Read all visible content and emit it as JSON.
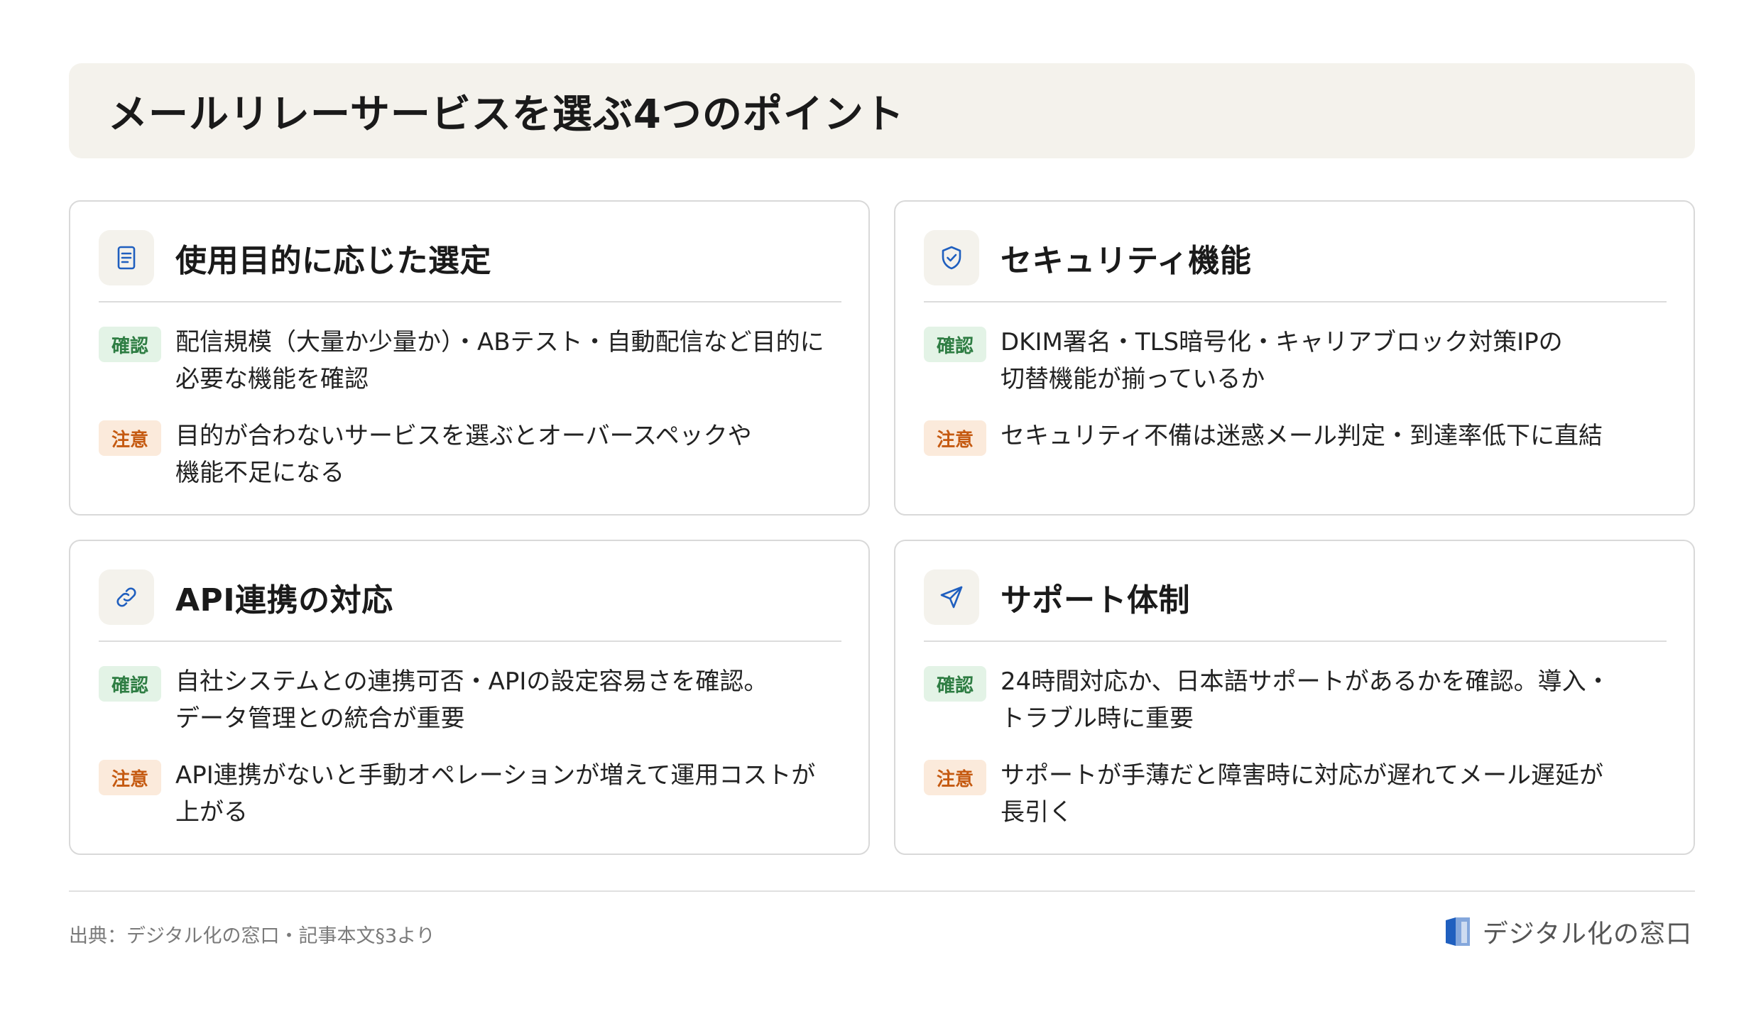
{
  "title": "メールリレーサービスを選ぶ4つのポイント",
  "labels": {
    "confirm": "確認",
    "caution": "注意"
  },
  "cards": [
    {
      "icon": "document-icon",
      "heading": "使用目的に応じた選定",
      "confirm_lines": [
        "配信規模（大量か少量か）・ABテスト・自動配信など目的に",
        "必要な機能を確認"
      ],
      "caution_lines": [
        "目的が合わないサービスを選ぶとオーバースペックや",
        "機能不足になる"
      ]
    },
    {
      "icon": "shield-check-icon",
      "heading": "セキュリティ機能",
      "confirm_lines": [
        "DKIM署名・TLS暗号化・キャリアブロック対策IPの",
        "切替機能が揃っているか"
      ],
      "caution_lines": [
        "セキュリティ不備は迷惑メール判定・到達率低下に直結"
      ]
    },
    {
      "icon": "link-icon",
      "heading": "API連携の対応",
      "confirm_lines": [
        "自社システムとの連携可否・APIの設定容易さを確認。",
        "データ管理との統合が重要"
      ],
      "caution_lines": [
        "API連携がないと手動オペレーションが増えて運用コストが",
        "上がる"
      ]
    },
    {
      "icon": "send-icon",
      "heading": "サポート体制",
      "confirm_lines": [
        "24時間対応か、日本語サポートがあるかを確認。導入・",
        "トラブル時に重要"
      ],
      "caution_lines": [
        "サポートが手薄だと障害時に対応が遅れてメール遅延が",
        "長引く"
      ]
    }
  ],
  "footer": {
    "source": "出典：デジタル化の窓口・記事本文§3より",
    "brand": "デジタル化の窓口"
  },
  "colors": {
    "accent_blue": "#1f5fbf",
    "confirm_bg": "#e3f3e6",
    "confirm_text": "#2e7d43",
    "caution_bg": "#fbeadb",
    "caution_text": "#c55a11",
    "title_bg": "#f4f2ec"
  }
}
